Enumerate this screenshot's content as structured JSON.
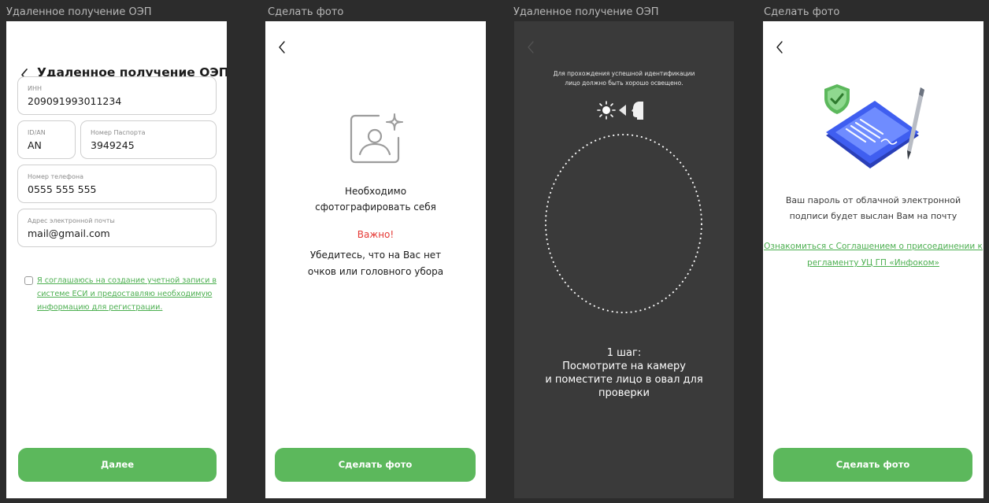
{
  "frames": [
    {
      "label": "Удаленное получение ОЭП"
    },
    {
      "label": "Сделать фото"
    },
    {
      "label": "Удаленное получение ОЭП"
    },
    {
      "label": "Сделать фото"
    }
  ],
  "screen1": {
    "title": "Удаленное получение ОЭП",
    "fields": {
      "inn": {
        "label": "ИНН",
        "value": "209091993011234"
      },
      "id_an": {
        "label": "ID/AN",
        "value": "AN"
      },
      "passport": {
        "label": "Номер Паспорта",
        "value": "3949245"
      },
      "phone": {
        "label": "Номер телефона",
        "value": "0555 555 555"
      },
      "email": {
        "label": "Адрес электронной почты",
        "value": "mail@gmail.com"
      }
    },
    "agreement_line1": "Я соглашаюсь на создание учетной записи в",
    "agreement_line2": "системе ЕСИ и предоставляю необходимую",
    "agreement_line3": "информацию для регистрации.",
    "next_button": "Далее"
  },
  "screen2": {
    "line1": "Необходимо",
    "line2": "сфотографировать себя",
    "important": "Важно!",
    "note_line1": "Убедитесь, что на Вас нет",
    "note_line2": "очков или головного убора",
    "button": "Сделать фото",
    "important_color": "#e53935"
  },
  "screen3": {
    "hint_line1": "Для прохождения успешной идентификации",
    "hint_line2": "лицо должно быть хорошо освещено.",
    "step": "1 шаг:",
    "instr_line1": "Посмотрите на камеру",
    "instr_line2": "и поместите лицо в овал для",
    "instr_line3": "проверки"
  },
  "screen4": {
    "line1": "Ваш пароль от облачной электронной",
    "line2": "подписи будет выслан Вам на почту",
    "link_line1": "Ознакомиться с Соглашением о присоединении к",
    "link_line2": "регламенту УЦ ГП «Инфоком»",
    "button": "Сделать фото"
  },
  "colors": {
    "accent": "#5cb85c",
    "link": "#4caf50",
    "background": "#2c2c2c",
    "dark_screen": "#3a3a3a"
  },
  "icons": [
    "chevron-left-icon",
    "photo-user-icon",
    "sun-icon",
    "face-profile-icon",
    "shield-check-icon",
    "phone-document-icon",
    "pen-icon"
  ]
}
